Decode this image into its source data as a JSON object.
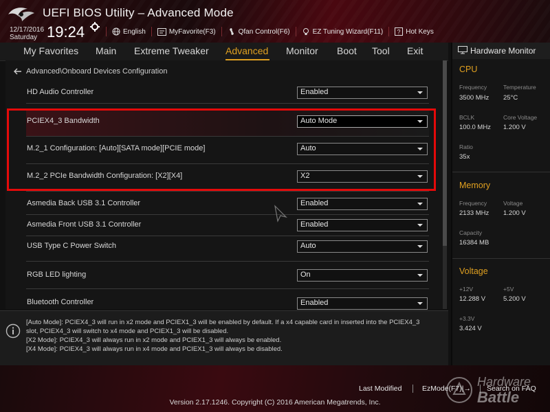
{
  "header": {
    "title": "UEFI BIOS Utility – Advanced Mode",
    "date": "12/17/2016",
    "day": "Saturday",
    "time": "19:24",
    "toolbar": [
      "English",
      "MyFavorite(F3)",
      "Qfan Control(F6)",
      "EZ Tuning Wizard(F11)",
      "Hot Keys"
    ]
  },
  "tabs": [
    "My Favorites",
    "Main",
    "Extreme Tweaker",
    "Advanced",
    "Monitor",
    "Boot",
    "Tool",
    "Exit"
  ],
  "active_tab": "Advanced",
  "breadcrumb": "Advanced\\Onboard Devices Configuration",
  "settings": [
    {
      "label": "HD Audio Controller",
      "value": "Enabled"
    },
    {
      "label": "PCIEX4_3 Bandwidth",
      "value": "Auto Mode"
    },
    {
      "label": "M.2_1 Configuration: [Auto][SATA mode][PCIE mode]",
      "value": "Auto"
    },
    {
      "label": "M.2_2 PCIe Bandwidth Configuration: [X2][X4]",
      "value": "X2"
    },
    {
      "label": "Asmedia Back USB 3.1 Controller",
      "value": "Enabled"
    },
    {
      "label": "Asmedia Front USB 3.1 Controller",
      "value": "Enabled"
    },
    {
      "label": "USB Type C Power Switch",
      "value": "Auto"
    },
    {
      "label": "RGB LED lighting",
      "value": "On"
    },
    {
      "label": "Bluetooth Controller",
      "value": "Enabled"
    }
  ],
  "help_text": [
    "[Auto Mode]: PCIEX4_3 will run in x2 mode and PCIEX1_3 will be enabled by default. If a x4 capable card in inserted into the PCIEX4_3",
    "slot, PCIEX4_3 will switch to x4 mode and PCIEX1_3 will be disabled.",
    "[X2 Mode]: PCIEX4_3 will always run in x2 mode and PCIEX1_3 will always be enabled.",
    "[X4 Mode]: PCIEX4_3 will always run in x4 mode and PCIEX1_3 will always be disabled."
  ],
  "hardware_monitor": {
    "title": "Hardware Monitor",
    "cpu": {
      "heading": "CPU",
      "frequency_label": "Frequency",
      "frequency": "3500 MHz",
      "temperature_label": "Temperature",
      "temperature": "25°C",
      "bclk_label": "BCLK",
      "bclk": "100.0 MHz",
      "core_voltage_label": "Core Voltage",
      "core_voltage": "1.200 V",
      "ratio_label": "Ratio",
      "ratio": "35x"
    },
    "memory": {
      "heading": "Memory",
      "frequency_label": "Frequency",
      "frequency": "2133 MHz",
      "voltage_label": "Voltage",
      "voltage": "1.200 V",
      "capacity_label": "Capacity",
      "capacity": "16384 MB"
    },
    "voltage": {
      "heading": "Voltage",
      "v12_label": "+12V",
      "v12": "12.288 V",
      "v5_label": "+5V",
      "v5": "5.200 V",
      "v33_label": "+3.3V",
      "v33": "3.424 V"
    }
  },
  "footer": {
    "last_modified": "Last Modified",
    "ezmode": "EzMode(F7)|→",
    "search": "Search on FAQ",
    "version": "Version 2.17.1246. Copyright (C) 2016 American Megatrends, Inc.",
    "watermark_1": "Hardware",
    "watermark_2": "Battle"
  },
  "colors": {
    "accent": "#e0a020",
    "highlight_box": "#e50a0a",
    "brand_red": "#4a0810"
  }
}
